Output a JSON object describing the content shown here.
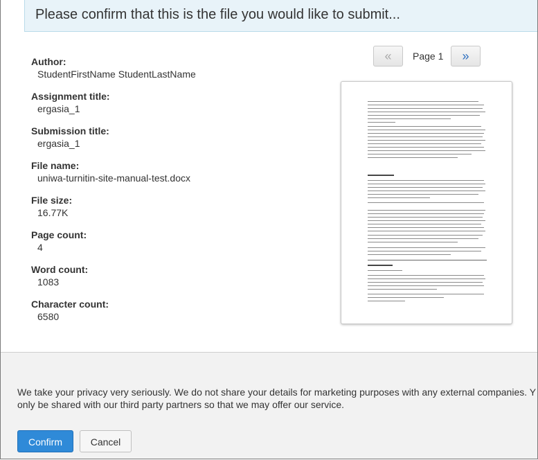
{
  "header": {
    "title": "Please confirm that this is the file you would like to submit..."
  },
  "details": [
    {
      "label": "Author:",
      "value": "StudentFirstName StudentLastName"
    },
    {
      "label": "Assignment title:",
      "value": "ergasia_1"
    },
    {
      "label": "Submission title:",
      "value": "ergasia_1"
    },
    {
      "label": "File name:",
      "value": "uniwa-turnitin-site-manual-test.docx"
    },
    {
      "label": "File size:",
      "value": "16.77K"
    },
    {
      "label": "Page count:",
      "value": "4"
    },
    {
      "label": "Word count:",
      "value": "1083"
    },
    {
      "label": "Character count:",
      "value": "6580"
    }
  ],
  "pager": {
    "prev_label": "«",
    "page_label": "Page 1",
    "next_label": "»"
  },
  "preview": {
    "icon": "document-page-thumbnail"
  },
  "footer": {
    "privacy_line1": "We take your privacy very seriously. We do not share your details for marketing purposes with any external companies. Y",
    "privacy_line2": "only be shared with our third party partners so that we may offer our service.",
    "confirm_label": "Confirm",
    "cancel_label": "Cancel"
  },
  "colors": {
    "banner_bg": "#e8f3f9",
    "confirm_bg": "#2f8ad8",
    "next_arrow": "#2d6fc0"
  }
}
